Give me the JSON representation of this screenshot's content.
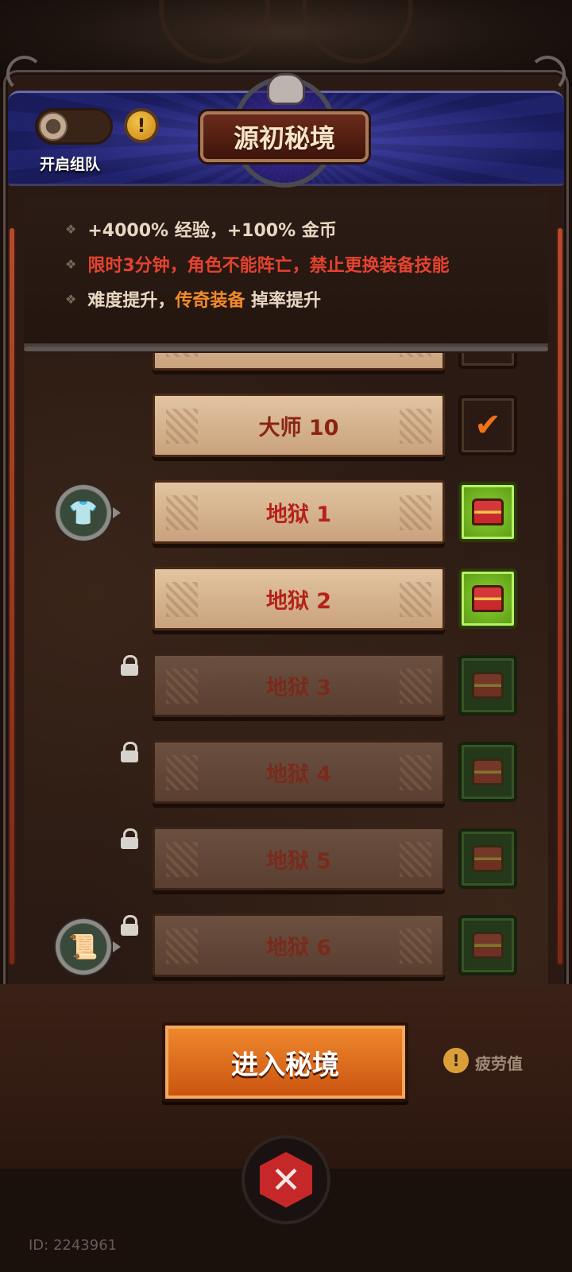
{
  "header": {
    "team_toggle_label": "开启组队",
    "info_symbol": "!",
    "title": "源初秘境"
  },
  "info": {
    "line1": "+4000% 经验，+100% 金币",
    "line2": "限时3分钟，角色不能阵亡，禁止更换装备技能",
    "line3_a": "难度提升，",
    "line3_b": "传奇装备",
    "line3_c": " 掉率提升",
    "bullet": "❖"
  },
  "levels": [
    {
      "label": "",
      "state": "unlocked",
      "reward": "dark"
    },
    {
      "label": "大师 10",
      "state": "completed",
      "reward": "check"
    },
    {
      "label": "地狱 1",
      "state": "unlocked",
      "reward": "chest-green",
      "side_icon": "armor-icon"
    },
    {
      "label": "地狱 2",
      "state": "unlocked",
      "reward": "chest-green"
    },
    {
      "label": "地狱 3",
      "state": "locked",
      "reward": "chest-dim"
    },
    {
      "label": "地狱 4",
      "state": "locked",
      "reward": "chest-dim"
    },
    {
      "label": "地狱 5",
      "state": "locked",
      "reward": "chest-dim"
    },
    {
      "label": "地狱 6",
      "state": "locked",
      "reward": "chest-dim",
      "side_icon": "scroll-icon"
    }
  ],
  "footer": {
    "enter_button": "进入秘境",
    "fatigue_label": "疲劳值",
    "fatigue_symbol": "!",
    "user_id": "ID: 2243961"
  },
  "colors": {
    "accent_orange": "#f28a2b",
    "warning_red": "#e5432f",
    "header_blue": "#2b2f8f"
  }
}
